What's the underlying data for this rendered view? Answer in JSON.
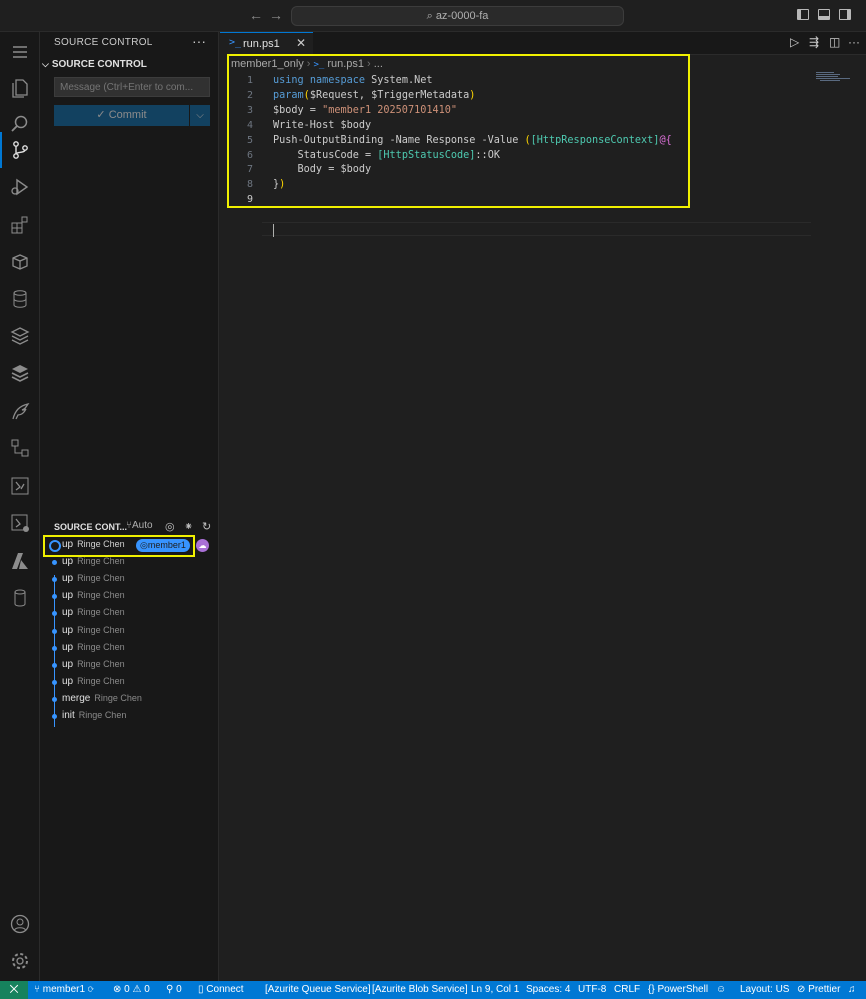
{
  "titlebar": {
    "search_text": "az-0000-fa"
  },
  "sidebar": {
    "title": "SOURCE CONTROL",
    "section": "SOURCE CONTROL",
    "message_placeholder": "Message (Ctrl+Enter to com...",
    "commit_label": "Commit",
    "graph": {
      "header": "SOURCE CONT...",
      "auto_label": "Auto",
      "commits": [
        {
          "message": "up",
          "author": "Ringe Chen",
          "branch": "member1"
        },
        {
          "message": "up",
          "author": "Ringe Chen"
        },
        {
          "message": "up",
          "author": "Ringe Chen"
        },
        {
          "message": "up",
          "author": "Ringe Chen"
        },
        {
          "message": "up",
          "author": "Ringe Chen"
        },
        {
          "message": "up",
          "author": "Ringe Chen"
        },
        {
          "message": "up",
          "author": "Ringe Chen"
        },
        {
          "message": "up",
          "author": "Ringe Chen"
        },
        {
          "message": "up",
          "author": "Ringe Chen"
        },
        {
          "message": "merge",
          "author": "Ringe Chen"
        },
        {
          "message": "init",
          "author": "Ringe Chen"
        }
      ]
    }
  },
  "editor": {
    "tab_label": "run.ps1",
    "tab_icon_glyph": ">_",
    "breadcrumb": {
      "folder": "member1_only",
      "file": "run.ps1",
      "more": "..."
    },
    "current_line": 9,
    "code_lines": [
      "using namespace System.Net",
      "param($Request, $TriggerMetadata)",
      "$body = \"member1 202507101410\"",
      "Write-Host $body",
      "Push-OutputBinding -Name Response -Value ([HttpResponseContext]@{",
      "    StatusCode = [HttpStatusCode]::OK",
      "    Body = $body",
      "})",
      ""
    ]
  },
  "statusbar": {
    "branch": "member1",
    "errors": "0",
    "warnings": "0",
    "ports": "0",
    "connect": "Connect",
    "queue": "[Azurite Queue Service]",
    "blob": "[Azurite Blob Service]",
    "position": "Ln 9, Col 1",
    "spaces": "Spaces: 4",
    "encoding": "UTF-8",
    "eol": "CRLF",
    "language": "PowerShell",
    "layout": "Layout: US",
    "prettier": "Prettier"
  },
  "colors": {
    "accent": "#0078d4",
    "highlight_box": "#f0f000",
    "remote": "#16825d"
  }
}
